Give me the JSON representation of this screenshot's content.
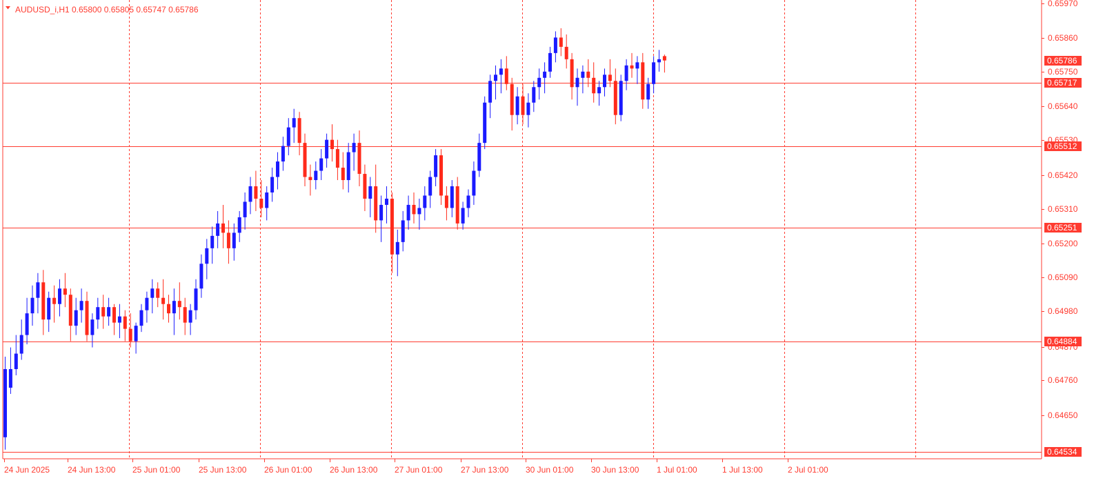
{
  "header": {
    "symbol": "AUDUSD_i,H1",
    "ohlc": "0.65800 0.65805 0.65747 0.65786"
  },
  "colors": {
    "bull": "#1a1aff",
    "bear": "#ff2a1a",
    "doji": "#22cc22",
    "grid": "#ff3b30",
    "level": "#ff3b30",
    "text": "#ff3b30",
    "background": "#ffffff"
  },
  "price_axis_labels": [
    "0.65970",
    "0.65860",
    "0.65750",
    "0.65640",
    "0.65530",
    "0.65420",
    "0.65310",
    "0.65200",
    "0.65090",
    "0.64980",
    "0.64870",
    "0.64760",
    "0.64650"
  ],
  "time_axis_labels": [
    "24 Jun 2025",
    "24 Jun 13:00",
    "25 Jun 01:00",
    "25 Jun 13:00",
    "26 Jun 01:00",
    "26 Jun 13:00",
    "27 Jun 01:00",
    "27 Jun 13:00",
    "30 Jun 01:00",
    "30 Jun 13:00",
    "1 Jul 01:00",
    "1 Jul 13:00",
    "2 Jul 01:00"
  ],
  "horizontal_levels": [
    "0.65717",
    "0.65512",
    "0.65251",
    "0.64884",
    "0.64534"
  ],
  "current_price": "0.65786",
  "chart_data": {
    "type": "candlestick",
    "symbol": "AUDUSD_i",
    "timeframe": "H1",
    "ylim": [
      0.6452,
      0.6598
    ],
    "x": [
      "24 Jun 2025",
      "24 Jun 13:00",
      "25 Jun 01:00",
      "25 Jun 13:00",
      "26 Jun 01:00",
      "26 Jun 13:00",
      "27 Jun 01:00",
      "27 Jun 13:00",
      "30 Jun 01:00",
      "30 Jun 13:00",
      "1 Jul 01:00",
      "1 Jul 13:00",
      "2 Jul 01:00"
    ],
    "levels": [
      0.65717,
      0.65512,
      0.65251,
      0.64884,
      0.64534
    ],
    "candles": [
      {
        "o": 0.6457,
        "h": 0.6483,
        "l": 0.6453,
        "c": 0.6479
      },
      {
        "o": 0.6473,
        "h": 0.6486,
        "l": 0.6471,
        "c": 0.6479
      },
      {
        "o": 0.6479,
        "h": 0.649,
        "l": 0.6477,
        "c": 0.6484
      },
      {
        "o": 0.6484,
        "h": 0.6495,
        "l": 0.6482,
        "c": 0.649
      },
      {
        "o": 0.649,
        "h": 0.6502,
        "l": 0.6487,
        "c": 0.6497
      },
      {
        "o": 0.6497,
        "h": 0.6506,
        "l": 0.6493,
        "c": 0.6502
      },
      {
        "o": 0.6502,
        "h": 0.651,
        "l": 0.6497,
        "c": 0.6507
      },
      {
        "o": 0.6507,
        "h": 0.6511,
        "l": 0.649,
        "c": 0.6495
      },
      {
        "o": 0.6495,
        "h": 0.6504,
        "l": 0.6491,
        "c": 0.6502
      },
      {
        "o": 0.6502,
        "h": 0.6506,
        "l": 0.6494,
        "c": 0.65
      },
      {
        "o": 0.65,
        "h": 0.6508,
        "l": 0.6496,
        "c": 0.6505
      },
      {
        "o": 0.6505,
        "h": 0.651,
        "l": 0.6499,
        "c": 0.6503
      },
      {
        "o": 0.6503,
        "h": 0.6505,
        "l": 0.6488,
        "c": 0.6493
      },
      {
        "o": 0.6493,
        "h": 0.6502,
        "l": 0.649,
        "c": 0.6498
      },
      {
        "o": 0.6498,
        "h": 0.6505,
        "l": 0.6494,
        "c": 0.6501
      },
      {
        "o": 0.6501,
        "h": 0.6504,
        "l": 0.6488,
        "c": 0.649
      },
      {
        "o": 0.649,
        "h": 0.6497,
        "l": 0.6486,
        "c": 0.6495
      },
      {
        "o": 0.6495,
        "h": 0.6502,
        "l": 0.6492,
        "c": 0.6499
      },
      {
        "o": 0.6499,
        "h": 0.6503,
        "l": 0.6492,
        "c": 0.6496
      },
      {
        "o": 0.6496,
        "h": 0.6502,
        "l": 0.6493,
        "c": 0.6499
      },
      {
        "o": 0.6499,
        "h": 0.65,
        "l": 0.649,
        "c": 0.6494
      },
      {
        "o": 0.6494,
        "h": 0.65,
        "l": 0.6489,
        "c": 0.6496
      },
      {
        "o": 0.6496,
        "h": 0.6498,
        "l": 0.6488,
        "c": 0.6492
      },
      {
        "o": 0.6492,
        "h": 0.6497,
        "l": 0.6486,
        "c": 0.6488
      },
      {
        "o": 0.6488,
        "h": 0.6494,
        "l": 0.6484,
        "c": 0.6493
      },
      {
        "o": 0.6493,
        "h": 0.65,
        "l": 0.6491,
        "c": 0.6498
      },
      {
        "o": 0.6498,
        "h": 0.6504,
        "l": 0.6494,
        "c": 0.6502
      },
      {
        "o": 0.6502,
        "h": 0.6508,
        "l": 0.6497,
        "c": 0.6505
      },
      {
        "o": 0.6505,
        "h": 0.6507,
        "l": 0.6499,
        "c": 0.6502
      },
      {
        "o": 0.6502,
        "h": 0.6508,
        "l": 0.6495,
        "c": 0.65
      },
      {
        "o": 0.65,
        "h": 0.6503,
        "l": 0.6494,
        "c": 0.6497
      },
      {
        "o": 0.6497,
        "h": 0.6505,
        "l": 0.649,
        "c": 0.6501
      },
      {
        "o": 0.6501,
        "h": 0.6507,
        "l": 0.6495,
        "c": 0.6499
      },
      {
        "o": 0.6499,
        "h": 0.6502,
        "l": 0.649,
        "c": 0.6494
      },
      {
        "o": 0.6494,
        "h": 0.65,
        "l": 0.649,
        "c": 0.6498
      },
      {
        "o": 0.6498,
        "h": 0.6508,
        "l": 0.6495,
        "c": 0.6505
      },
      {
        "o": 0.6505,
        "h": 0.6516,
        "l": 0.6502,
        "c": 0.6513
      },
      {
        "o": 0.6513,
        "h": 0.6521,
        "l": 0.6508,
        "c": 0.6518
      },
      {
        "o": 0.6518,
        "h": 0.6525,
        "l": 0.6513,
        "c": 0.6522
      },
      {
        "o": 0.6522,
        "h": 0.653,
        "l": 0.6518,
        "c": 0.6526
      },
      {
        "o": 0.6526,
        "h": 0.6532,
        "l": 0.6518,
        "c": 0.6523
      },
      {
        "o": 0.6523,
        "h": 0.6527,
        "l": 0.6513,
        "c": 0.6518
      },
      {
        "o": 0.6518,
        "h": 0.6526,
        "l": 0.6514,
        "c": 0.6523
      },
      {
        "o": 0.6523,
        "h": 0.653,
        "l": 0.652,
        "c": 0.6528
      },
      {
        "o": 0.6528,
        "h": 0.6536,
        "l": 0.6524,
        "c": 0.6533
      },
      {
        "o": 0.6533,
        "h": 0.6541,
        "l": 0.6529,
        "c": 0.6538
      },
      {
        "o": 0.6538,
        "h": 0.6543,
        "l": 0.653,
        "c": 0.6534
      },
      {
        "o": 0.6534,
        "h": 0.654,
        "l": 0.6528,
        "c": 0.6531
      },
      {
        "o": 0.6531,
        "h": 0.6538,
        "l": 0.6527,
        "c": 0.6536
      },
      {
        "o": 0.6536,
        "h": 0.6544,
        "l": 0.6533,
        "c": 0.6541
      },
      {
        "o": 0.6541,
        "h": 0.6549,
        "l": 0.6537,
        "c": 0.6546
      },
      {
        "o": 0.6546,
        "h": 0.6554,
        "l": 0.6543,
        "c": 0.6551
      },
      {
        "o": 0.6551,
        "h": 0.656,
        "l": 0.6548,
        "c": 0.6557
      },
      {
        "o": 0.6557,
        "h": 0.6563,
        "l": 0.6552,
        "c": 0.656
      },
      {
        "o": 0.656,
        "h": 0.6562,
        "l": 0.6548,
        "c": 0.6552
      },
      {
        "o": 0.6552,
        "h": 0.6555,
        "l": 0.6538,
        "c": 0.6541
      },
      {
        "o": 0.6541,
        "h": 0.6545,
        "l": 0.6535,
        "c": 0.654
      },
      {
        "o": 0.654,
        "h": 0.6546,
        "l": 0.6537,
        "c": 0.6543
      },
      {
        "o": 0.6543,
        "h": 0.655,
        "l": 0.654,
        "c": 0.6547
      },
      {
        "o": 0.6547,
        "h": 0.6555,
        "l": 0.6544,
        "c": 0.6553
      },
      {
        "o": 0.6553,
        "h": 0.6558,
        "l": 0.6546,
        "c": 0.655
      },
      {
        "o": 0.655,
        "h": 0.6553,
        "l": 0.654,
        "c": 0.6544
      },
      {
        "o": 0.6544,
        "h": 0.6549,
        "l": 0.6537,
        "c": 0.654
      },
      {
        "o": 0.654,
        "h": 0.6552,
        "l": 0.6536,
        "c": 0.6549
      },
      {
        "o": 0.6549,
        "h": 0.6555,
        "l": 0.6543,
        "c": 0.6552
      },
      {
        "o": 0.6552,
        "h": 0.6556,
        "l": 0.6538,
        "c": 0.6542
      },
      {
        "o": 0.6542,
        "h": 0.6545,
        "l": 0.653,
        "c": 0.6534
      },
      {
        "o": 0.6534,
        "h": 0.6541,
        "l": 0.6528,
        "c": 0.6538
      },
      {
        "o": 0.6538,
        "h": 0.6545,
        "l": 0.6523,
        "c": 0.6527
      },
      {
        "o": 0.6527,
        "h": 0.6535,
        "l": 0.652,
        "c": 0.6532
      },
      {
        "o": 0.6532,
        "h": 0.6538,
        "l": 0.6526,
        "c": 0.6534
      },
      {
        "o": 0.6534,
        "h": 0.6536,
        "l": 0.651,
        "c": 0.6516
      },
      {
        "o": 0.6516,
        "h": 0.6524,
        "l": 0.6509,
        "c": 0.652
      },
      {
        "o": 0.652,
        "h": 0.653,
        "l": 0.6517,
        "c": 0.6527
      },
      {
        "o": 0.6527,
        "h": 0.6535,
        "l": 0.6524,
        "c": 0.6532
      },
      {
        "o": 0.6532,
        "h": 0.6536,
        "l": 0.6526,
        "c": 0.6529
      },
      {
        "o": 0.6529,
        "h": 0.6534,
        "l": 0.6524,
        "c": 0.6531
      },
      {
        "o": 0.6531,
        "h": 0.6538,
        "l": 0.6527,
        "c": 0.6535
      },
      {
        "o": 0.6535,
        "h": 0.6543,
        "l": 0.6531,
        "c": 0.6541
      },
      {
        "o": 0.6541,
        "h": 0.655,
        "l": 0.6538,
        "c": 0.6548
      },
      {
        "o": 0.6548,
        "h": 0.655,
        "l": 0.6532,
        "c": 0.6535
      },
      {
        "o": 0.6535,
        "h": 0.6538,
        "l": 0.6527,
        "c": 0.6531
      },
      {
        "o": 0.6531,
        "h": 0.654,
        "l": 0.6528,
        "c": 0.6538
      },
      {
        "o": 0.6538,
        "h": 0.6541,
        "l": 0.6524,
        "c": 0.6526
      },
      {
        "o": 0.6526,
        "h": 0.6533,
        "l": 0.6524,
        "c": 0.6531
      },
      {
        "o": 0.6531,
        "h": 0.6537,
        "l": 0.6528,
        "c": 0.6535
      },
      {
        "o": 0.6535,
        "h": 0.6546,
        "l": 0.6532,
        "c": 0.6543
      },
      {
        "o": 0.6543,
        "h": 0.6555,
        "l": 0.6541,
        "c": 0.6552
      },
      {
        "o": 0.6552,
        "h": 0.6567,
        "l": 0.655,
        "c": 0.6565
      },
      {
        "o": 0.6565,
        "h": 0.6574,
        "l": 0.656,
        "c": 0.6572
      },
      {
        "o": 0.6572,
        "h": 0.6577,
        "l": 0.6566,
        "c": 0.6574
      },
      {
        "o": 0.6574,
        "h": 0.6579,
        "l": 0.6568,
        "c": 0.6576
      },
      {
        "o": 0.6576,
        "h": 0.658,
        "l": 0.6569,
        "c": 0.6571
      },
      {
        "o": 0.6571,
        "h": 0.6573,
        "l": 0.6556,
        "c": 0.6561
      },
      {
        "o": 0.6561,
        "h": 0.657,
        "l": 0.6558,
        "c": 0.6567
      },
      {
        "o": 0.6567,
        "h": 0.6571,
        "l": 0.6558,
        "c": 0.6561
      },
      {
        "o": 0.6561,
        "h": 0.6568,
        "l": 0.6557,
        "c": 0.6565
      },
      {
        "o": 0.6565,
        "h": 0.6572,
        "l": 0.6562,
        "c": 0.657
      },
      {
        "o": 0.657,
        "h": 0.6576,
        "l": 0.6566,
        "c": 0.6573
      },
      {
        "o": 0.6573,
        "h": 0.6578,
        "l": 0.6568,
        "c": 0.6575
      },
      {
        "o": 0.6575,
        "h": 0.6583,
        "l": 0.6573,
        "c": 0.6581
      },
      {
        "o": 0.6581,
        "h": 0.6588,
        "l": 0.6578,
        "c": 0.6586
      },
      {
        "o": 0.6586,
        "h": 0.6589,
        "l": 0.658,
        "c": 0.6583
      },
      {
        "o": 0.6583,
        "h": 0.6587,
        "l": 0.6576,
        "c": 0.6579
      },
      {
        "o": 0.6579,
        "h": 0.6581,
        "l": 0.6566,
        "c": 0.657
      },
      {
        "o": 0.657,
        "h": 0.6576,
        "l": 0.6564,
        "c": 0.6573
      },
      {
        "o": 0.6573,
        "h": 0.6577,
        "l": 0.6568,
        "c": 0.6575
      },
      {
        "o": 0.6575,
        "h": 0.6579,
        "l": 0.657,
        "c": 0.6573
      },
      {
        "o": 0.6573,
        "h": 0.6578,
        "l": 0.6565,
        "c": 0.6568
      },
      {
        "o": 0.6568,
        "h": 0.6572,
        "l": 0.6564,
        "c": 0.657
      },
      {
        "o": 0.657,
        "h": 0.6576,
        "l": 0.6567,
        "c": 0.6574
      },
      {
        "o": 0.6574,
        "h": 0.6579,
        "l": 0.657,
        "c": 0.6572
      },
      {
        "o": 0.6572,
        "h": 0.6576,
        "l": 0.6558,
        "c": 0.6561
      },
      {
        "o": 0.6561,
        "h": 0.6574,
        "l": 0.6559,
        "c": 0.6572
      },
      {
        "o": 0.6572,
        "h": 0.6579,
        "l": 0.6569,
        "c": 0.6577
      },
      {
        "o": 0.6577,
        "h": 0.6581,
        "l": 0.6573,
        "c": 0.6576
      },
      {
        "o": 0.6576,
        "h": 0.658,
        "l": 0.6571,
        "c": 0.6578
      },
      {
        "o": 0.6578,
        "h": 0.6581,
        "l": 0.6563,
        "c": 0.6566
      },
      {
        "o": 0.6566,
        "h": 0.6573,
        "l": 0.6563,
        "c": 0.6571
      },
      {
        "o": 0.6571,
        "h": 0.658,
        "l": 0.6568,
        "c": 0.6578
      },
      {
        "o": 0.6578,
        "h": 0.6582,
        "l": 0.6575,
        "c": 0.6579
      },
      {
        "o": 0.658,
        "h": 0.65805,
        "l": 0.65747,
        "c": 0.65786
      }
    ]
  }
}
